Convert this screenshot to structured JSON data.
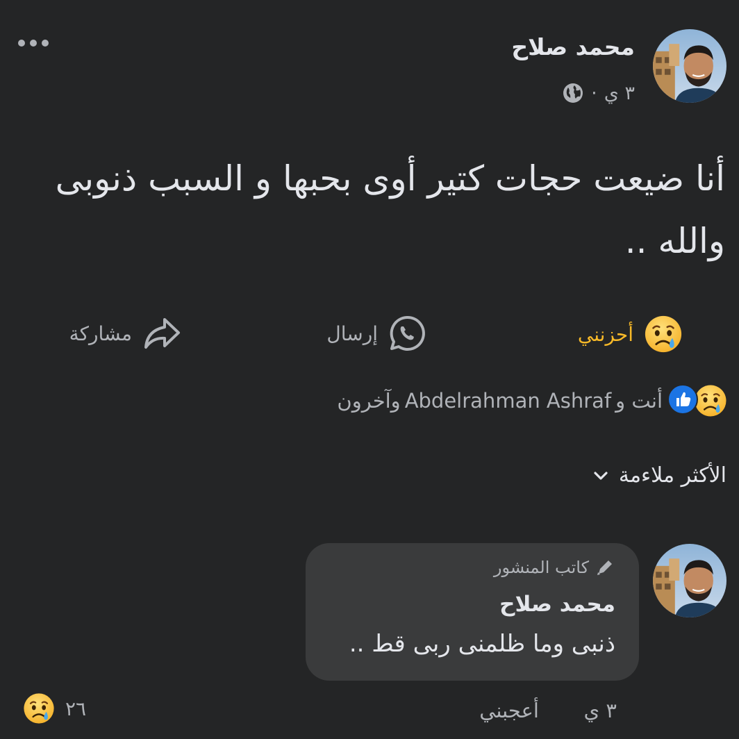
{
  "post": {
    "author": "محمد صلاح",
    "time": "٣ ي",
    "separator": "·",
    "text": "أنا ضيعت حجات كتير أوى بحبها و السبب ذنوبى والله .."
  },
  "actions": {
    "reaction": {
      "label": "أحزنني",
      "icon": "sad-emoji"
    },
    "send": {
      "label": "إرسال",
      "icon": "whatsapp-icon"
    },
    "share": {
      "label": "مشاركة",
      "icon": "share-arrow-icon"
    }
  },
  "reactions_summary": {
    "you": "أنت و",
    "name": "Abdelrahman Ashraf",
    "others": " وآخرون"
  },
  "sort": {
    "label": "الأكثر ملاءمة"
  },
  "comment": {
    "badge": "كاتب المنشور",
    "author": "محمد صلاح",
    "text": "ذنبى وما ظلمنى ربى قط ..",
    "time": "٣ ي",
    "like_label": "أعجبني",
    "reaction_count": "٢٦"
  },
  "colors": {
    "background": "#242526",
    "bubble": "#3a3b3c",
    "reaction_accent": "#f7b928",
    "like_blue": "#1b74e4"
  }
}
